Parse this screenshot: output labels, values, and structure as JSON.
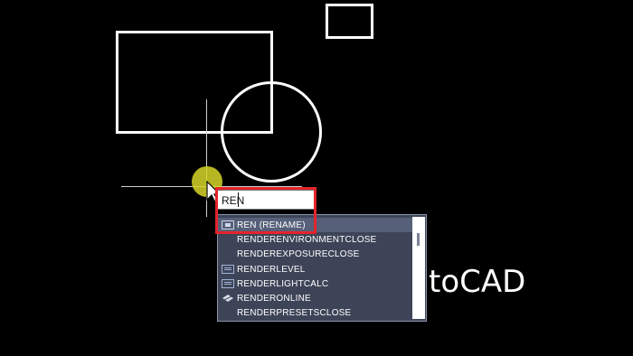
{
  "command_input": {
    "value": "REN"
  },
  "autocomplete": {
    "items": [
      {
        "label": "REN (RENAME)",
        "icon": "command-icon",
        "selected": true
      },
      {
        "label": "RENDERENVIRONMENTCLOSE",
        "icon": "",
        "selected": false
      },
      {
        "label": "RENDEREXPOSURECLOSE",
        "icon": "",
        "selected": false
      },
      {
        "label": "RENDERLEVEL",
        "icon": "system-variable-icon",
        "selected": false
      },
      {
        "label": "RENDERLIGHTCALC",
        "icon": "system-variable-icon",
        "selected": false
      },
      {
        "label": "RENDERONLINE",
        "icon": "cloud-render-icon",
        "selected": false
      },
      {
        "label": "RENDERPRESETSCLOSE",
        "icon": "",
        "selected": false
      }
    ]
  },
  "brand_fragment": "toCAD",
  "colors": {
    "background": "#000000",
    "geometry": "#ffffff",
    "highlight_frame": "#e3242b",
    "cursor_highlight": "#d6d628",
    "dropdown_bg": "#3e4458",
    "dropdown_selected": "#566079"
  }
}
